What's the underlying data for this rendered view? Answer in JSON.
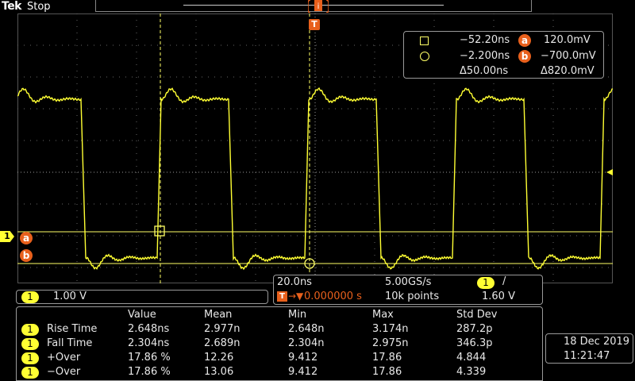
{
  "header": {
    "brand": "Tek",
    "run_state": "Stop"
  },
  "trigger_marker": {
    "label": "T"
  },
  "cursors": {
    "cursor1": {
      "time": "−52.20ns",
      "marker": "a",
      "voltage": "120.0mV"
    },
    "cursor2": {
      "time": "−2.200ns",
      "marker": "b",
      "voltage": "−700.0mV"
    },
    "delta_time": "Δ50.00ns",
    "delta_voltage": "Δ820.0mV"
  },
  "side_markers": {
    "channel": "1",
    "cursor_a": "a",
    "cursor_b": "b"
  },
  "channel_scale": {
    "channel": "1",
    "value": "1.00 V"
  },
  "horizontal": {
    "time_per_div": "20.0ns",
    "sample_rate": "5.00GS/s",
    "trigger_channel": "1",
    "trigger_slope": "/",
    "position_prefix": "T",
    "position": "0.000000 s",
    "record_length": "10k points",
    "trigger_level": "1.60 V"
  },
  "measurements": {
    "headers": [
      "Value",
      "Mean",
      "Min",
      "Max",
      "Std Dev"
    ],
    "rows": [
      {
        "channel": "1",
        "name": "Rise Time",
        "value": "2.648ns",
        "mean": "2.977n",
        "min": "2.648n",
        "max": "3.174n",
        "std": "287.2p"
      },
      {
        "channel": "1",
        "name": "Fall Time",
        "value": "2.304ns",
        "mean": "2.689n",
        "min": "2.304n",
        "max": "2.975n",
        "std": "346.3p"
      },
      {
        "channel": "1",
        "name": "+Over",
        "value": "17.86 %",
        "mean": "12.26",
        "min": "9.412",
        "max": "17.86",
        "std": "4.844"
      },
      {
        "channel": "1",
        "name": "−Over",
        "value": "17.86 %",
        "mean": "13.06",
        "min": "9.412",
        "max": "17.86",
        "std": "4.339"
      }
    ]
  },
  "datetime": {
    "date": "18 Dec  2019",
    "time": "11:21:47"
  },
  "colors": {
    "trace": "#ffff33",
    "accent": "#e8601c",
    "grid": "#8a8a8a"
  }
}
